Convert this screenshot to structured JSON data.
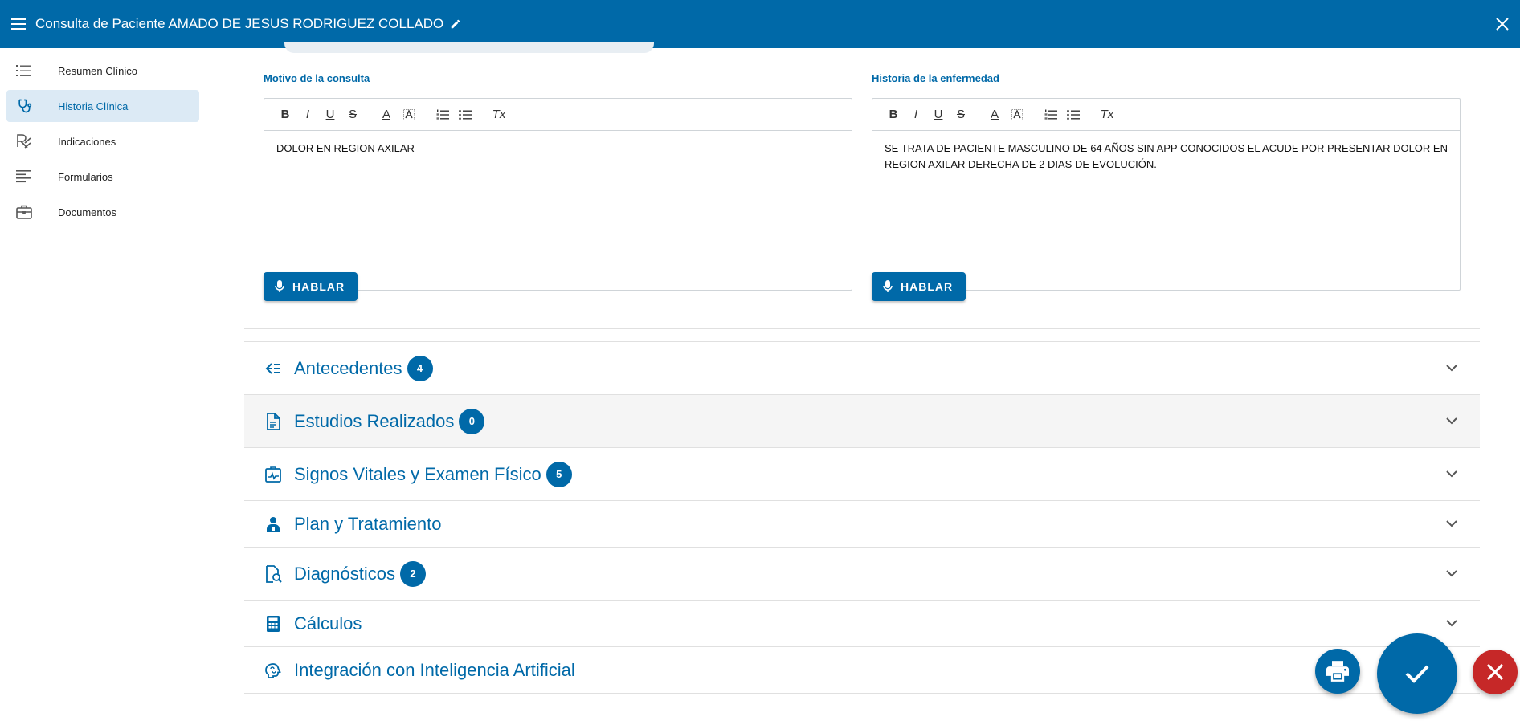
{
  "header": {
    "title": "Consulta de Paciente AMADO DE JESUS RODRIGUEZ COLLADO",
    "menu_icon": "menu-icon",
    "edit_icon": "pencil-icon",
    "close_icon": "close-icon"
  },
  "sidebar": {
    "items": [
      {
        "label": "Resumen Clínico",
        "icon": "list-icon"
      },
      {
        "label": "Historia Clínica",
        "icon": "stethoscope-icon"
      },
      {
        "label": "Indicaciones",
        "icon": "rx-icon"
      },
      {
        "label": "Formularios",
        "icon": "lines-icon"
      },
      {
        "label": "Documentos",
        "icon": "briefcase-icon"
      }
    ]
  },
  "motivo": {
    "label": "Motivo de la consulta",
    "text": "DOLOR EN REGION AXILAR",
    "talk_label": "HABLAR"
  },
  "historia": {
    "label": "Historia de la enfermedad",
    "text": "SE TRATA DE PACIENTE MASCULINO DE 64 AÑOS SIN APP CONOCIDOS EL ACUDE POR PRESENTAR DOLOR EN REGION AXILAR DERECHA DE 2 DIAS DE EVOLUCIÓN.",
    "talk_label": "HABLAR"
  },
  "toolbar": {
    "bold": "B",
    "italic": "I",
    "underline": "U",
    "strike": "S",
    "font_color": "A",
    "clear": "Tx"
  },
  "panels": [
    {
      "title": "Antecedentes",
      "badge": "4",
      "icon": "indent-arrow-icon"
    },
    {
      "title": "Estudios Realizados",
      "badge": "0",
      "icon": "document-icon"
    },
    {
      "title": "Signos Vitales y Examen Físico",
      "badge": "5",
      "icon": "vitals-icon"
    },
    {
      "title": "Plan y Tratamiento",
      "badge": "",
      "icon": "doctor-icon"
    },
    {
      "title": "Diagnósticos",
      "badge": "2",
      "icon": "doc-search-icon"
    },
    {
      "title": "Cálculos",
      "badge": "",
      "icon": "calculator-icon"
    },
    {
      "title": "Integración con Inteligencia Artificial",
      "badge": "",
      "icon": "brain-icon"
    }
  ],
  "colors": {
    "primary": "#0069a8",
    "danger": "#c62828",
    "active_bg": "#dceaf5"
  }
}
